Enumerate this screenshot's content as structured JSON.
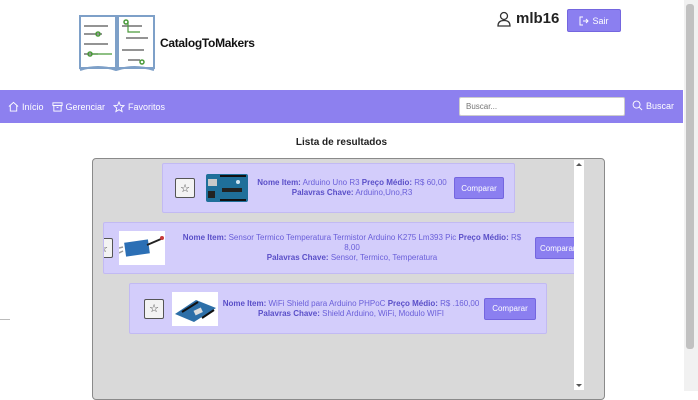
{
  "app": {
    "logo_text": "CatalogToMakers",
    "user_name": "mlb16",
    "logout_label": "Sair"
  },
  "nav": {
    "items": [
      {
        "label": "Início",
        "icon": "home-icon"
      },
      {
        "label": "Gerenciar",
        "icon": "box-icon"
      },
      {
        "label": "Favoritos",
        "icon": "star-icon"
      }
    ],
    "search_placeholder": "Buscar...",
    "search_label": "Buscar"
  },
  "results": {
    "title": "Lista de resultados",
    "name_label": "Nome Item:",
    "price_label": "Preço Médio:",
    "keywords_label": "Palavras Chave:",
    "compare_label": "Comparar",
    "items": [
      {
        "name": "Arduino Uno R3",
        "price": "R$ 60,00",
        "keywords": "Arduino,Uno,R3"
      },
      {
        "name": "Sensor Termico Temperatura Termistor Arduino K275 Lm393 Pic",
        "price": "R$ 8,00",
        "keywords": "Sensor, Termico, Temperatura"
      },
      {
        "name": "WiFi Shield para Arduino PHPoC",
        "price": "R$ .160,00",
        "keywords": "Shield Arduino, WiFi, Modulo WIFI"
      }
    ]
  },
  "colors": {
    "accent": "#8d80ef",
    "card": "#d3cdfb",
    "panel": "#d9d9d9"
  }
}
